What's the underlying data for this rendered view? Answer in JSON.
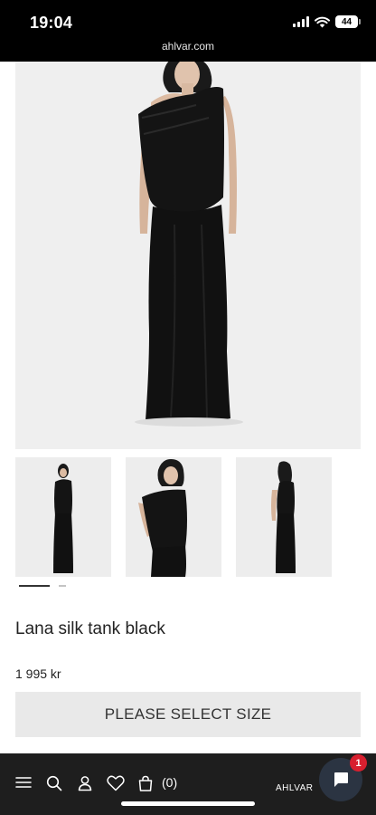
{
  "status_bar": {
    "time": "19:04",
    "battery": "44",
    "url": "ahlvar.com"
  },
  "product": {
    "name": "Lana silk tank black",
    "price": "1 995 kr",
    "select_size_label": "PLEASE SELECT SIZE"
  },
  "gallery": {
    "thumbnail_count": 3,
    "active_index": 0
  },
  "bottom_nav": {
    "cart_count": "(0)",
    "brand": "AHLVAR"
  },
  "chat": {
    "badge_count": "1"
  },
  "colors": {
    "status_bar_bg": "#000000",
    "nav_bg": "#1e1e1e",
    "button_bg": "#e9e9e9",
    "chat_bg": "#2b3442",
    "badge_bg": "#d8202f"
  },
  "icons": [
    "wifi-icon",
    "signal-icon",
    "menu-icon",
    "search-icon",
    "account-icon",
    "wishlist-icon",
    "cart-icon",
    "chat-icon"
  ]
}
